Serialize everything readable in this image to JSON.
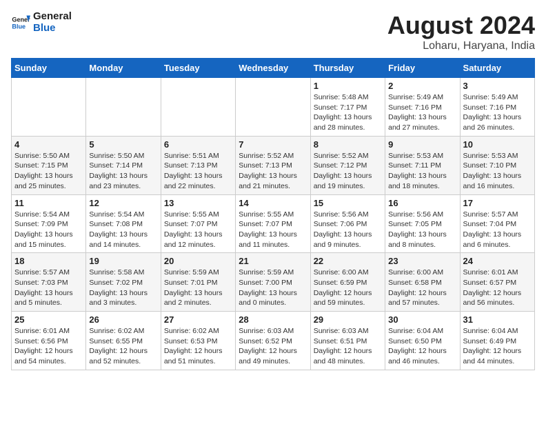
{
  "header": {
    "logo_general": "General",
    "logo_blue": "Blue",
    "title": "August 2024",
    "subtitle": "Loharu, Haryana, India"
  },
  "days_of_week": [
    "Sunday",
    "Monday",
    "Tuesday",
    "Wednesday",
    "Thursday",
    "Friday",
    "Saturday"
  ],
  "weeks": [
    [
      {
        "day": "",
        "info": ""
      },
      {
        "day": "",
        "info": ""
      },
      {
        "day": "",
        "info": ""
      },
      {
        "day": "",
        "info": ""
      },
      {
        "day": "1",
        "info": "Sunrise: 5:48 AM\nSunset: 7:17 PM\nDaylight: 13 hours\nand 28 minutes."
      },
      {
        "day": "2",
        "info": "Sunrise: 5:49 AM\nSunset: 7:16 PM\nDaylight: 13 hours\nand 27 minutes."
      },
      {
        "day": "3",
        "info": "Sunrise: 5:49 AM\nSunset: 7:16 PM\nDaylight: 13 hours\nand 26 minutes."
      }
    ],
    [
      {
        "day": "4",
        "info": "Sunrise: 5:50 AM\nSunset: 7:15 PM\nDaylight: 13 hours\nand 25 minutes."
      },
      {
        "day": "5",
        "info": "Sunrise: 5:50 AM\nSunset: 7:14 PM\nDaylight: 13 hours\nand 23 minutes."
      },
      {
        "day": "6",
        "info": "Sunrise: 5:51 AM\nSunset: 7:13 PM\nDaylight: 13 hours\nand 22 minutes."
      },
      {
        "day": "7",
        "info": "Sunrise: 5:52 AM\nSunset: 7:13 PM\nDaylight: 13 hours\nand 21 minutes."
      },
      {
        "day": "8",
        "info": "Sunrise: 5:52 AM\nSunset: 7:12 PM\nDaylight: 13 hours\nand 19 minutes."
      },
      {
        "day": "9",
        "info": "Sunrise: 5:53 AM\nSunset: 7:11 PM\nDaylight: 13 hours\nand 18 minutes."
      },
      {
        "day": "10",
        "info": "Sunrise: 5:53 AM\nSunset: 7:10 PM\nDaylight: 13 hours\nand 16 minutes."
      }
    ],
    [
      {
        "day": "11",
        "info": "Sunrise: 5:54 AM\nSunset: 7:09 PM\nDaylight: 13 hours\nand 15 minutes."
      },
      {
        "day": "12",
        "info": "Sunrise: 5:54 AM\nSunset: 7:08 PM\nDaylight: 13 hours\nand 14 minutes."
      },
      {
        "day": "13",
        "info": "Sunrise: 5:55 AM\nSunset: 7:07 PM\nDaylight: 13 hours\nand 12 minutes."
      },
      {
        "day": "14",
        "info": "Sunrise: 5:55 AM\nSunset: 7:07 PM\nDaylight: 13 hours\nand 11 minutes."
      },
      {
        "day": "15",
        "info": "Sunrise: 5:56 AM\nSunset: 7:06 PM\nDaylight: 13 hours\nand 9 minutes."
      },
      {
        "day": "16",
        "info": "Sunrise: 5:56 AM\nSunset: 7:05 PM\nDaylight: 13 hours\nand 8 minutes."
      },
      {
        "day": "17",
        "info": "Sunrise: 5:57 AM\nSunset: 7:04 PM\nDaylight: 13 hours\nand 6 minutes."
      }
    ],
    [
      {
        "day": "18",
        "info": "Sunrise: 5:57 AM\nSunset: 7:03 PM\nDaylight: 13 hours\nand 5 minutes."
      },
      {
        "day": "19",
        "info": "Sunrise: 5:58 AM\nSunset: 7:02 PM\nDaylight: 13 hours\nand 3 minutes."
      },
      {
        "day": "20",
        "info": "Sunrise: 5:59 AM\nSunset: 7:01 PM\nDaylight: 13 hours\nand 2 minutes."
      },
      {
        "day": "21",
        "info": "Sunrise: 5:59 AM\nSunset: 7:00 PM\nDaylight: 13 hours\nand 0 minutes."
      },
      {
        "day": "22",
        "info": "Sunrise: 6:00 AM\nSunset: 6:59 PM\nDaylight: 12 hours\nand 59 minutes."
      },
      {
        "day": "23",
        "info": "Sunrise: 6:00 AM\nSunset: 6:58 PM\nDaylight: 12 hours\nand 57 minutes."
      },
      {
        "day": "24",
        "info": "Sunrise: 6:01 AM\nSunset: 6:57 PM\nDaylight: 12 hours\nand 56 minutes."
      }
    ],
    [
      {
        "day": "25",
        "info": "Sunrise: 6:01 AM\nSunset: 6:56 PM\nDaylight: 12 hours\nand 54 minutes."
      },
      {
        "day": "26",
        "info": "Sunrise: 6:02 AM\nSunset: 6:55 PM\nDaylight: 12 hours\nand 52 minutes."
      },
      {
        "day": "27",
        "info": "Sunrise: 6:02 AM\nSunset: 6:53 PM\nDaylight: 12 hours\nand 51 minutes."
      },
      {
        "day": "28",
        "info": "Sunrise: 6:03 AM\nSunset: 6:52 PM\nDaylight: 12 hours\nand 49 minutes."
      },
      {
        "day": "29",
        "info": "Sunrise: 6:03 AM\nSunset: 6:51 PM\nDaylight: 12 hours\nand 48 minutes."
      },
      {
        "day": "30",
        "info": "Sunrise: 6:04 AM\nSunset: 6:50 PM\nDaylight: 12 hours\nand 46 minutes."
      },
      {
        "day": "31",
        "info": "Sunrise: 6:04 AM\nSunset: 6:49 PM\nDaylight: 12 hours\nand 44 minutes."
      }
    ]
  ]
}
